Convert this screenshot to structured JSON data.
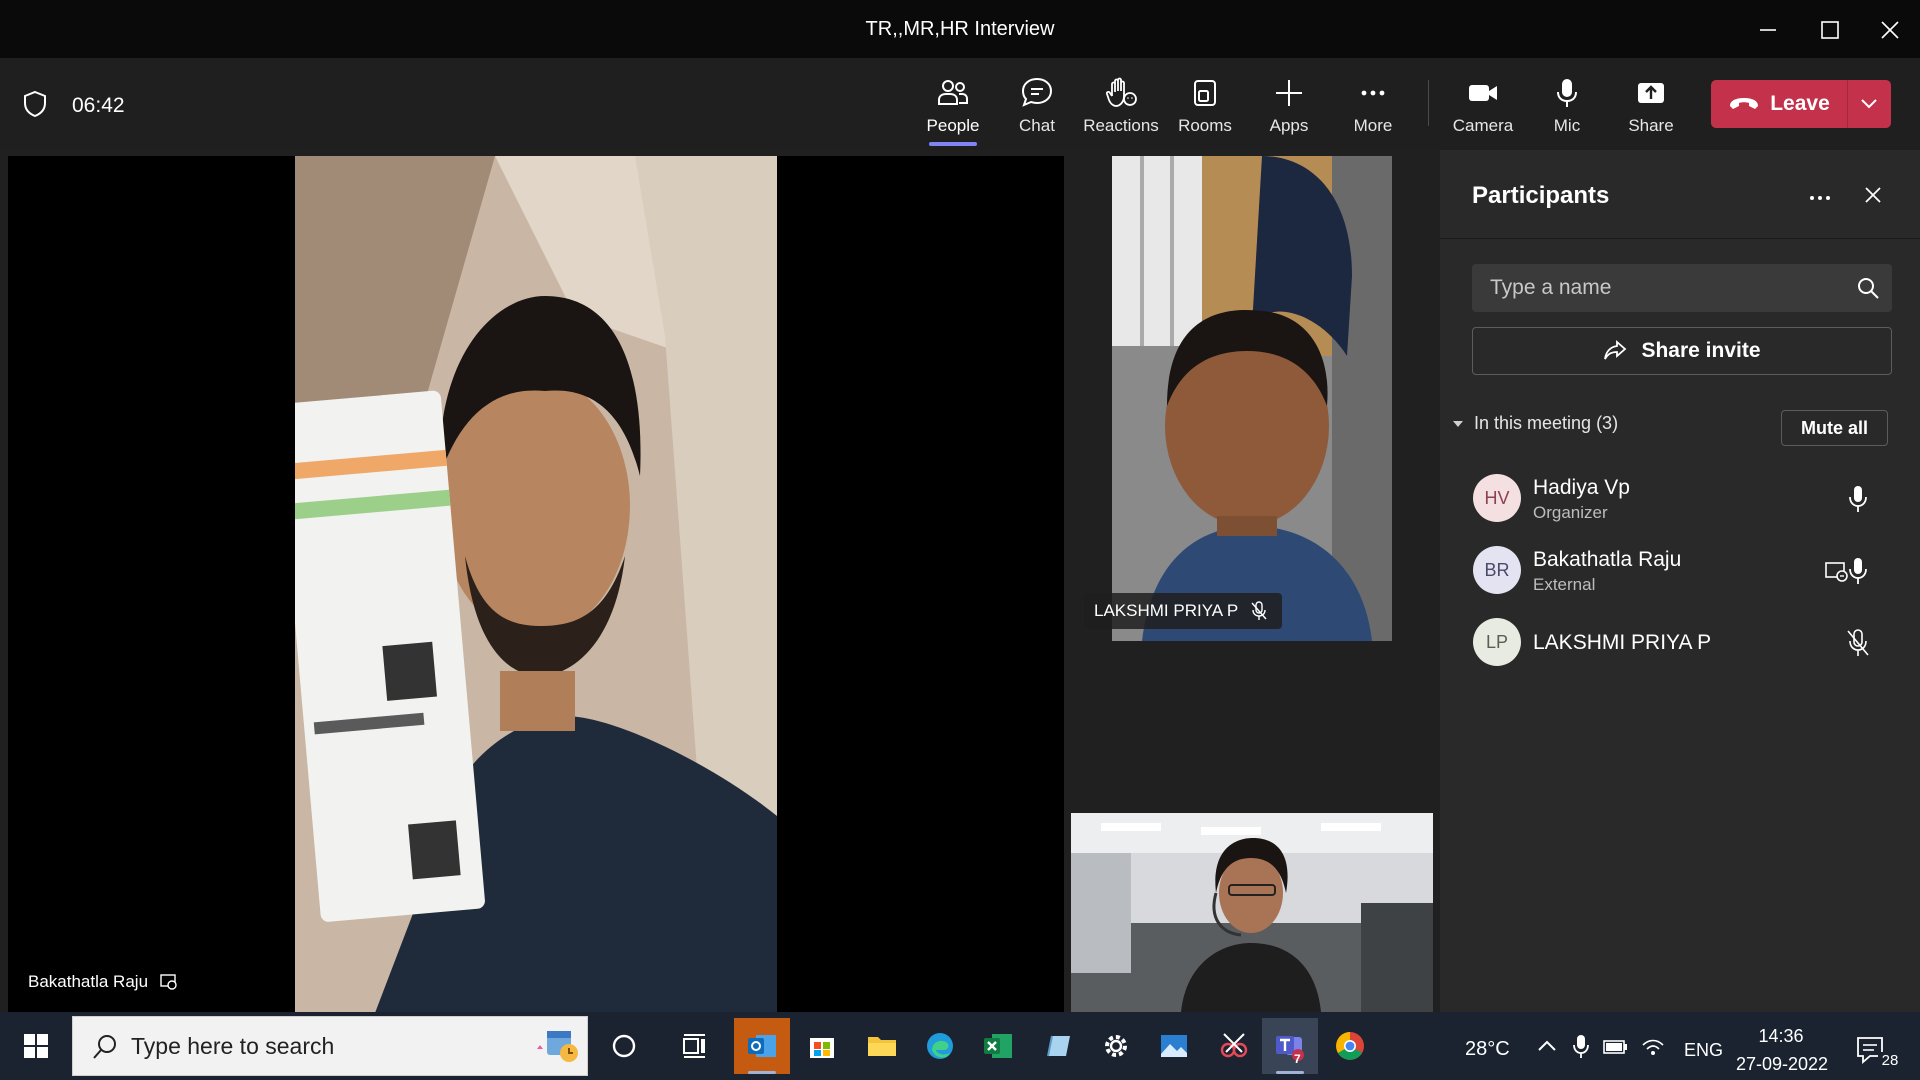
{
  "window": {
    "title": "TR,,MR,HR Interview"
  },
  "toolbar": {
    "timer": "06:42",
    "people_label": "People",
    "chat_label": "Chat",
    "reactions_label": "Reactions",
    "rooms_label": "Rooms",
    "apps_label": "Apps",
    "more_label": "More",
    "camera_label": "Camera",
    "mic_label": "Mic",
    "share_label": "Share",
    "leave_label": "Leave",
    "leave_color": "#c4314b",
    "active_underline_color": "#7f85f5"
  },
  "stage": {
    "main_name": "Bakathatla Raju",
    "tile1_name": "LAKSHMI PRIYA P"
  },
  "panel": {
    "title": "Participants",
    "search_placeholder": "Type a name",
    "share_invite": "Share invite",
    "section_label": "In this meeting (3)",
    "mute_all": "Mute all",
    "participants": [
      {
        "initials": "HV",
        "name": "Hadiya Vp",
        "role": "Organizer",
        "avatar_bg": "#f4dfe1",
        "avatar_fg": "#8c4250"
      },
      {
        "initials": "BR",
        "name": "Bakathatla Raju",
        "role": "External",
        "avatar_bg": "#e4e3f2",
        "avatar_fg": "#4a4a6a"
      },
      {
        "initials": "LP",
        "name": "LAKSHMI PRIYA P",
        "role": "",
        "avatar_bg": "#e8ebe2",
        "avatar_fg": "#5a6050"
      }
    ]
  },
  "taskbar": {
    "search_placeholder": "Type here to search",
    "temperature": "28°C",
    "language": "ENG",
    "time": "14:36",
    "date": "27-09-2022",
    "notification_count": "28",
    "teams_badge": "7"
  }
}
